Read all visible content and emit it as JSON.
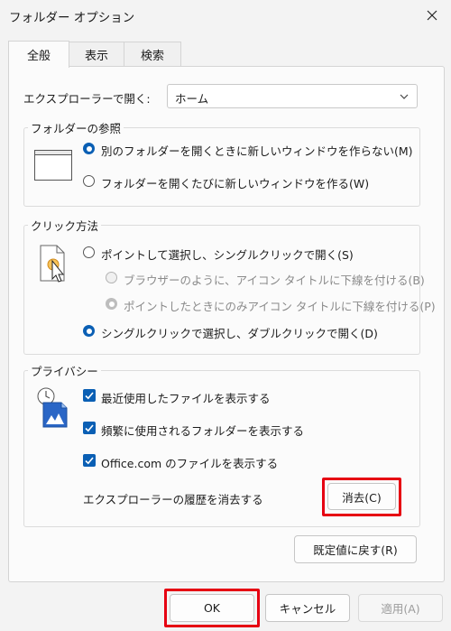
{
  "window": {
    "title": "フォルダー オプション"
  },
  "tabs": [
    {
      "label": "全般",
      "active": true
    },
    {
      "label": "表示",
      "active": false
    },
    {
      "label": "検索",
      "active": false
    }
  ],
  "explorer_open": {
    "label": "エクスプローラーで開く:",
    "value": "ホーム"
  },
  "browse": {
    "title": "フォルダーの参照",
    "options": [
      {
        "label": "別のフォルダーを開くときに新しいウィンドウを作らない(M)",
        "checked": true
      },
      {
        "label": "フォルダーを開くたびに新しいウィンドウを作る(W)",
        "checked": false
      }
    ]
  },
  "click": {
    "title": "クリック方法",
    "options": [
      {
        "label": "ポイントして選択し、シングルクリックで開く(S)",
        "checked": false,
        "enabled": true
      },
      {
        "label": "ブラウザーのように、アイコン タイトルに下線を付ける(B)",
        "checked": false,
        "enabled": false
      },
      {
        "label": "ポイントしたときにのみアイコン タイトルに下線を付ける(P)",
        "checked": true,
        "enabled": false
      },
      {
        "label": "シングルクリックで選択し、ダブルクリックで開く(D)",
        "checked": true,
        "enabled": true
      }
    ]
  },
  "privacy": {
    "title": "プライバシー",
    "checkboxes": [
      {
        "label": "最近使用したファイルを表示する",
        "checked": true
      },
      {
        "label": "頻繁に使用されるフォルダーを表示する",
        "checked": true
      },
      {
        "label": "Office.com のファイルを表示する",
        "checked": true
      }
    ],
    "clear_history_label": "エクスプローラーの履歴を消去する",
    "clear_button": "消去(C)"
  },
  "restore_defaults": "既定値に戻す(R)",
  "footer": {
    "ok": "OK",
    "cancel": "キャンセル",
    "apply": "適用(A)"
  },
  "colors": {
    "accent": "#0a5fb4",
    "highlight": "#e60012"
  }
}
